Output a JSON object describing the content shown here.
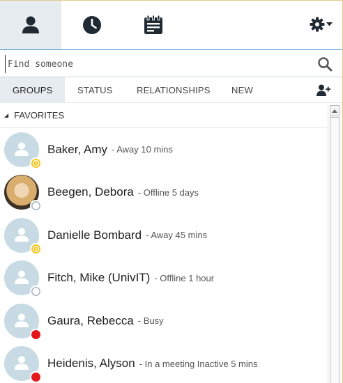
{
  "top_tabs": [
    {
      "name": "contacts",
      "icon": "person-icon",
      "active": true
    },
    {
      "name": "conversations",
      "icon": "clock-icon",
      "active": false
    },
    {
      "name": "meetings",
      "icon": "calendar-icon",
      "active": false
    }
  ],
  "settings": {
    "icon": "gear-icon"
  },
  "search": {
    "placeholder": "Find someone",
    "value": ""
  },
  "subtabs": [
    "GROUPS",
    "STATUS",
    "RELATIONSHIPS",
    "NEW"
  ],
  "group": {
    "name": "FAVORITES"
  },
  "contacts": [
    {
      "name": "Baker, Amy",
      "status": "- Away 10 mins",
      "presence": "away"
    },
    {
      "name": "Beegen, Debora",
      "status": "- Offline 5 days",
      "presence": "offline"
    },
    {
      "name": "Danielle Bombard",
      "status": "- Away 45 mins",
      "presence": "away"
    },
    {
      "name": "Fitch, Mike (UnivIT)",
      "status": "- Offline 1 hour",
      "presence": "offline"
    },
    {
      "name": "Gaura, Rebecca",
      "status": "- Busy",
      "presence": "busy"
    },
    {
      "name": "Heidenis, Alyson",
      "status": "- In a meeting Inactive 5 mins",
      "presence": "busy"
    }
  ],
  "colors": {
    "accent": "#3b8fd6",
    "away": "#f4c417",
    "busy": "#e3161b",
    "active_tab": "#e7ecf0"
  }
}
